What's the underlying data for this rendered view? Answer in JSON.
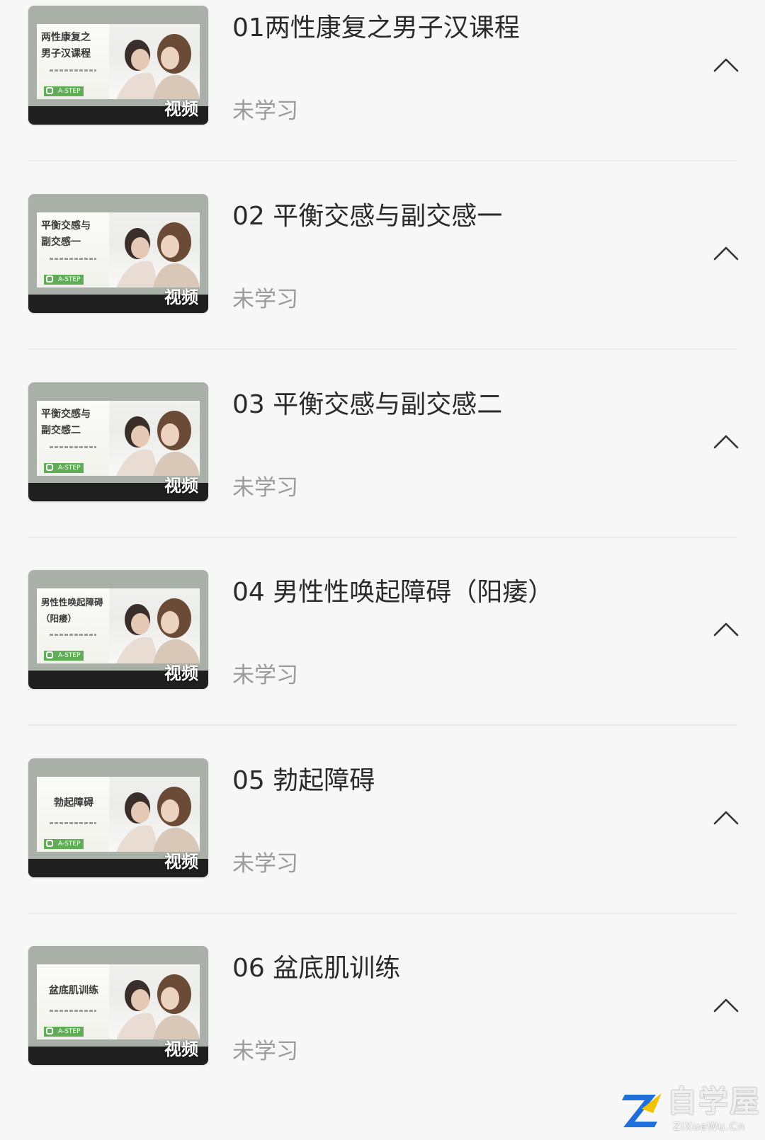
{
  "courses": [
    {
      "thumb_title": "两性康复之\n男子汉课程",
      "thumb_badge": "视频",
      "title": "01两性康复之男子汉课程",
      "status": "未学习",
      "expand_icon": "chevron-up-icon"
    },
    {
      "thumb_title": "平衡交感与\n副交感一",
      "thumb_badge": "视频",
      "title": "02 平衡交感与副交感一",
      "status": "未学习",
      "expand_icon": "chevron-up-icon"
    },
    {
      "thumb_title": "平衡交感与\n副交感二",
      "thumb_badge": "视频",
      "title": "03 平衡交感与副交感二",
      "status": "未学习",
      "expand_icon": "chevron-up-icon"
    },
    {
      "thumb_title": "男性性唤起障碍\n（阳痿）",
      "thumb_badge": "视频",
      "title": "04 男性性唤起障碍（阳痿）",
      "status": "未学习",
      "expand_icon": "chevron-up-icon"
    },
    {
      "thumb_title": "勃起障碍",
      "thumb_badge": "视频",
      "title": "05 勃起障碍",
      "status": "未学习",
      "expand_icon": "chevron-up-icon"
    },
    {
      "thumb_title": "盆底肌训练",
      "thumb_badge": "视频",
      "title": "06 盆底肌训练",
      "status": "未学习",
      "expand_icon": "chevron-up-icon"
    }
  ],
  "thumb_logo_text": "A-STEP",
  "watermark": {
    "text": "自学屋",
    "sub": "ZiXueWu.Cn"
  },
  "colors": {
    "background": "#f7f7f7",
    "title_text": "#2a2a2a",
    "status_text": "#9b9b9b",
    "divider": "#ececec",
    "thumb_frame": "#a9b0a8",
    "logo_green": "#5fae55",
    "watermark_blue": "#1e6fd9"
  }
}
